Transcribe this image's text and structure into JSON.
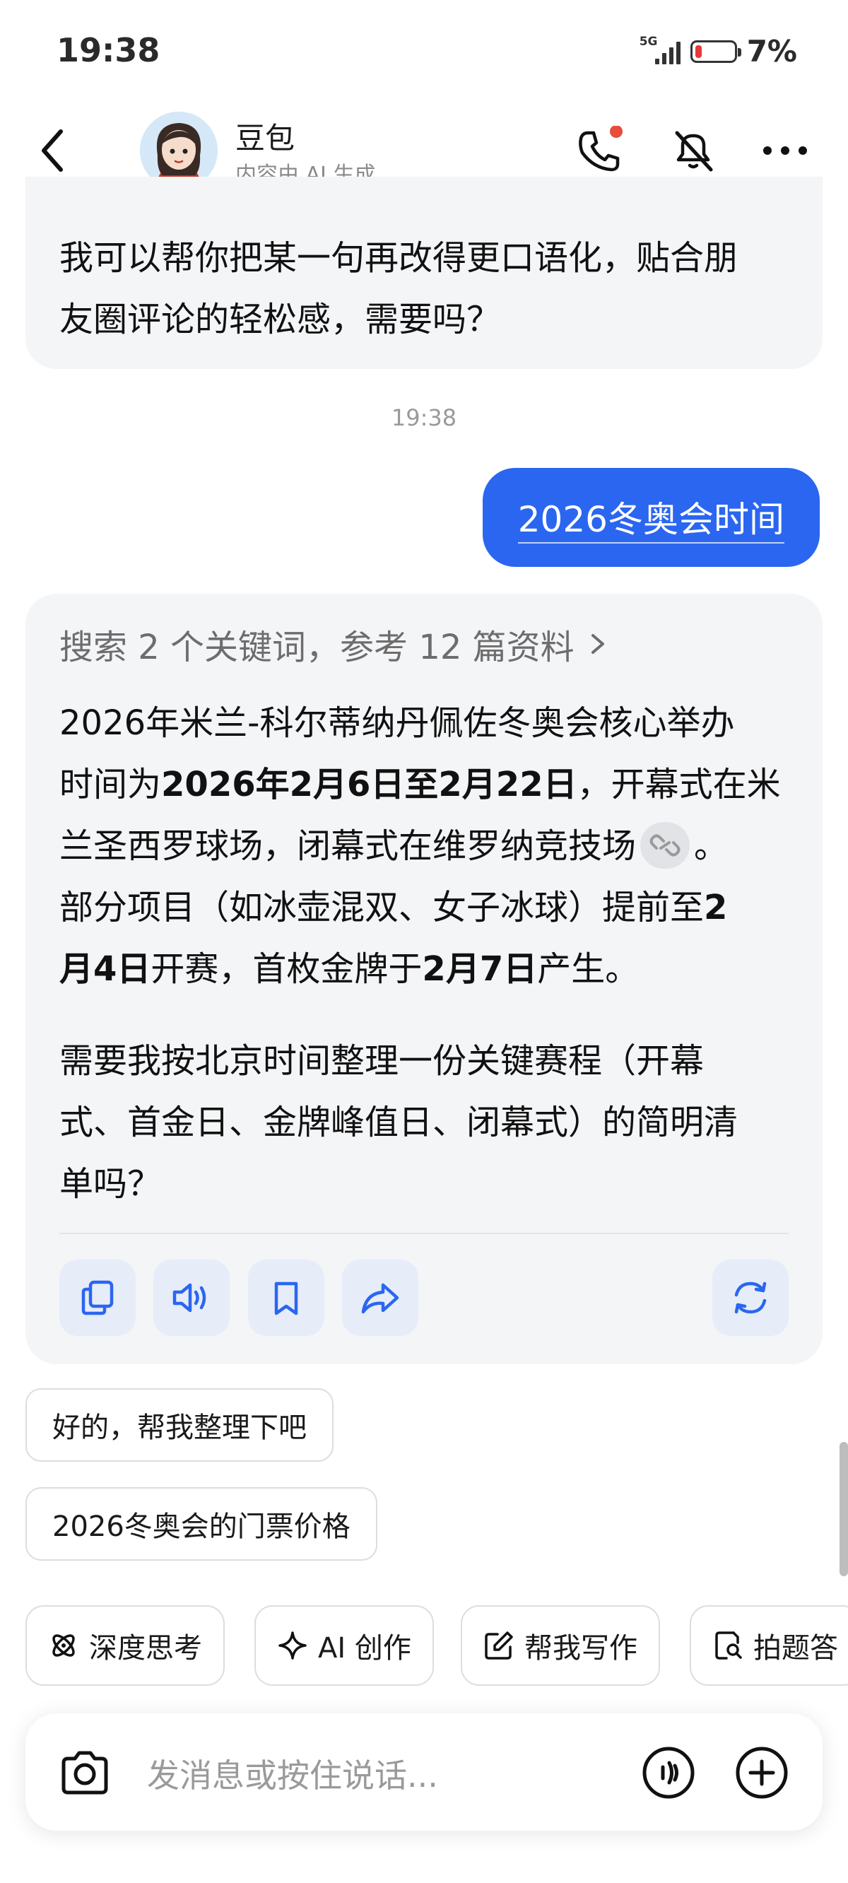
{
  "status_bar": {
    "time": "19:38",
    "network": "5G",
    "battery_percent": "7%",
    "battery_level": 0.07,
    "battery_color": "#e53935"
  },
  "header": {
    "name": "豆包",
    "subtitle": "内容由 AI 生成",
    "icons": [
      "back-icon",
      "phone-icon",
      "mute-icon",
      "more-icon"
    ],
    "phone_badge_color": "#e74c3c"
  },
  "chat": {
    "prev_ai_text": [
      "我可以帮你把某一句再改得更口语化，贴合朋",
      "友圈评论的轻松感，需要吗？"
    ],
    "timestamp": "19:38",
    "user_message": "2026冬奥会时间",
    "ai_reply": {
      "search_summary": "搜索 2 个关键词，参考 12 篇资料",
      "p1": {
        "l1": "2026年米兰-科尔蒂纳丹佩佐冬奥会核心举办",
        "l2a": "时间为",
        "l2b": "2026年2月6日至2月22日",
        "l2c": "，开幕式在米",
        "l3": "兰圣西罗球场，闭幕式在维罗纳竞技场",
        "l3end": "。",
        "l4a": "部分项目（如冰壶混双、女子冰球）提前至",
        "l4b": "2",
        "l5a": "月4日",
        "l5b": "开赛，首枚金牌于",
        "l5c": "2月7日",
        "l5d": "产生。"
      },
      "p2": [
        "需要我按北京时间整理一份关键赛程（开幕",
        "式、首金日、金牌峰值日、闭幕式）的简明清",
        "单吗？"
      ],
      "actions": [
        "copy-icon",
        "speaker-icon",
        "bookmark-icon",
        "share-icon",
        "refresh-icon"
      ]
    }
  },
  "suggestions": [
    "好的，帮我整理下吧",
    "2026冬奥会的门票价格"
  ],
  "tools": [
    {
      "label": "深度思考",
      "icon": "atom-icon"
    },
    {
      "label": "AI 创作",
      "icon": "sparkle-icon"
    },
    {
      "label": "帮我写作",
      "icon": "edit-icon"
    },
    {
      "label": "拍题答",
      "icon": "scan-doc-icon"
    }
  ],
  "input": {
    "placeholder": "发消息或按住说话..."
  },
  "colors": {
    "accent": "#2a66f0",
    "bubble": "#f4f5f7",
    "action_bg": "#e6ecf8"
  }
}
